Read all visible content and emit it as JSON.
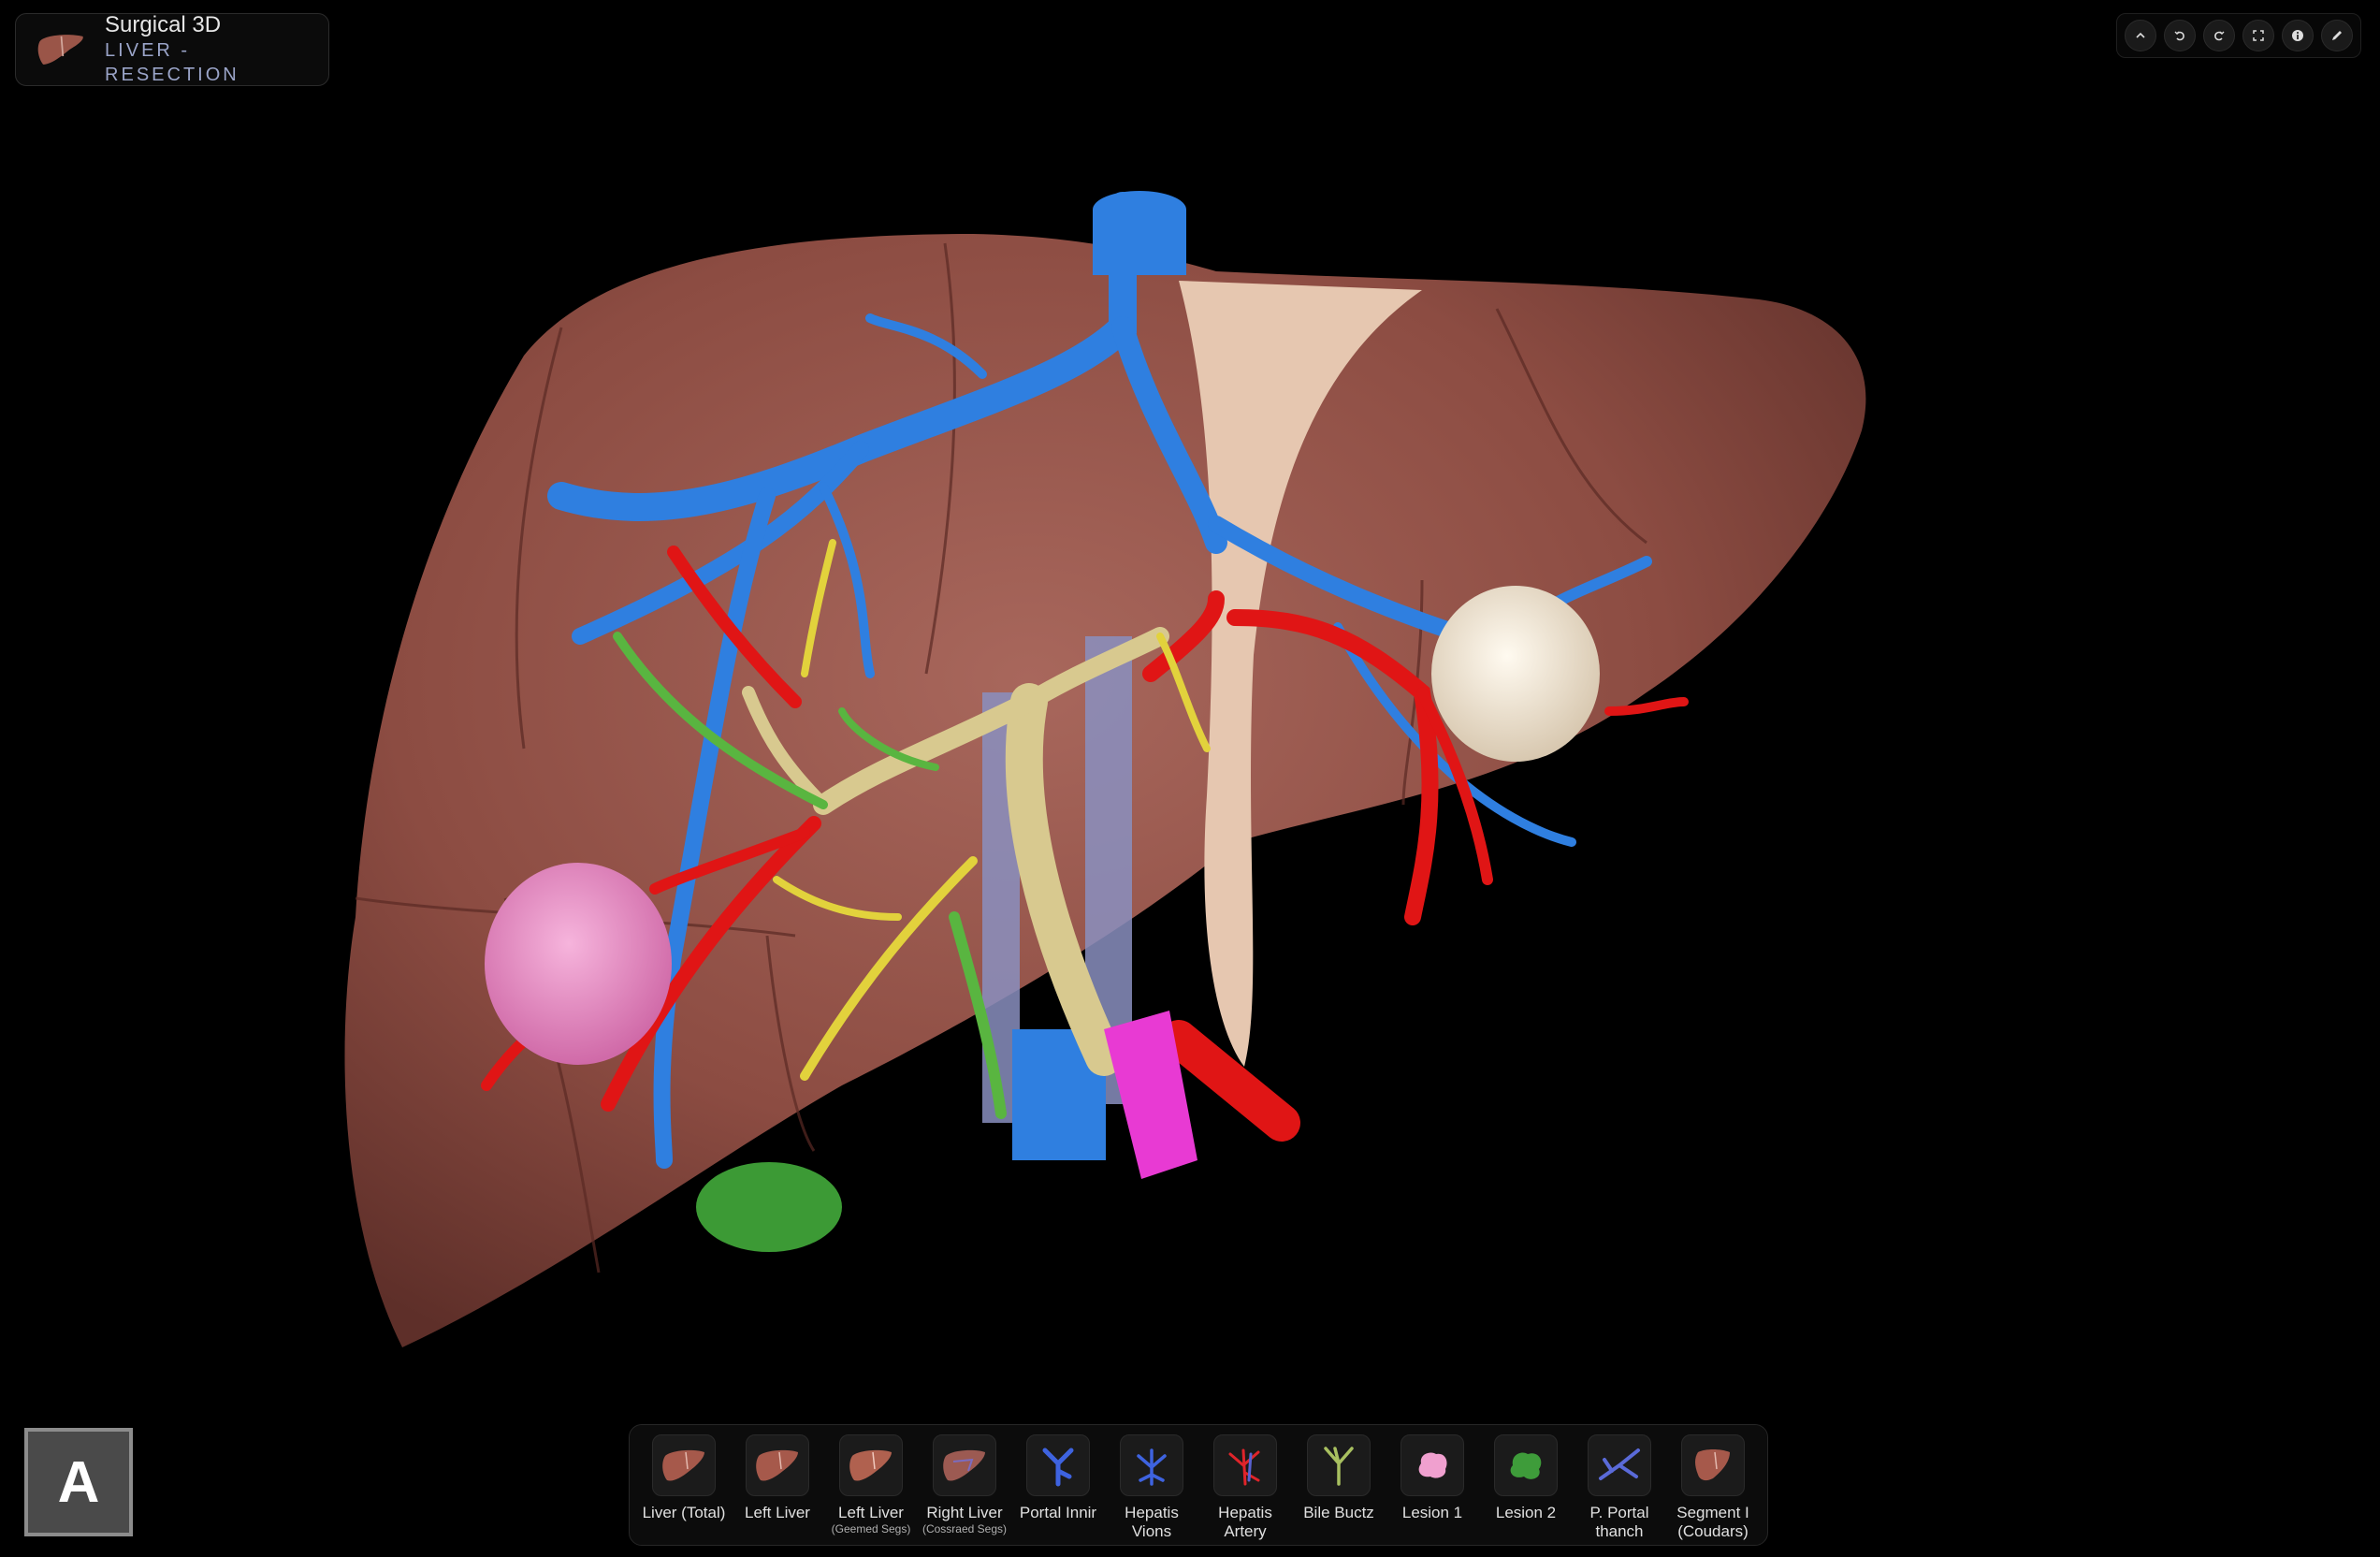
{
  "app": {
    "title": "Surgical 3D",
    "subtitle": "LIVER - RESECTION"
  },
  "toolbar": {
    "buttons": [
      {
        "name": "collapse-up-icon",
        "glyph": "^"
      },
      {
        "name": "undo-icon",
        "glyph": "↶"
      },
      {
        "name": "redo-icon",
        "glyph": "↷"
      },
      {
        "name": "fullscreen-icon",
        "glyph": "⛶"
      },
      {
        "name": "info-icon",
        "glyph": "i"
      },
      {
        "name": "pencil-icon",
        "glyph": "✎"
      }
    ]
  },
  "view_marker": {
    "label": "A"
  },
  "colors": {
    "liver": "#8a4a40",
    "hepatic_vein": "#2f7fe0",
    "portal_vein_ivc": "#8a8fc0",
    "hepatic_artery": "#e01515",
    "bile_duct": "#d8c98f",
    "bile_branch_yellow": "#e2d23c",
    "bile_branch_green": "#59b540",
    "lesion_1": "#e488c0",
    "lesion_2": "#f1e6d4",
    "gallbladder": "#3c9a35",
    "portal_stump": "#e83ad3",
    "falciform_ligament": "#e6c7b0"
  },
  "layers": [
    {
      "label": "Liver (Total)",
      "sub": "",
      "icon": "liver-icon"
    },
    {
      "label": "Left Liver",
      "sub": "",
      "icon": "liver-icon"
    },
    {
      "label": "Left Liver",
      "sub": "(Geemed Segs)",
      "icon": "liver-segment-icon"
    },
    {
      "label": "Right Liver",
      "sub": "(Cossraed Segs)",
      "icon": "liver-segment-icon"
    },
    {
      "label": "Portal Innir",
      "sub": "",
      "icon": "portal-vein-icon"
    },
    {
      "label": "Hepatis",
      "label2": "Vions",
      "sub": "",
      "icon": "hepatic-vein-icon"
    },
    {
      "label": "Hepatis",
      "label2": "Artery",
      "sub": "",
      "icon": "hepatic-artery-icon"
    },
    {
      "label": "Bile Buctz",
      "sub": "",
      "icon": "bile-duct-icon"
    },
    {
      "label": "Lesion 1",
      "sub": "",
      "icon": "lesion-pink-icon"
    },
    {
      "label": "Lesion 2",
      "sub": "",
      "icon": "lesion-green-icon"
    },
    {
      "label": "P. Portal",
      "label2": "thanch",
      "sub": "",
      "icon": "portal-branch-icon"
    },
    {
      "label": "Segment I",
      "label2": "(Coudars)",
      "sub": "",
      "icon": "liver-icon"
    }
  ]
}
